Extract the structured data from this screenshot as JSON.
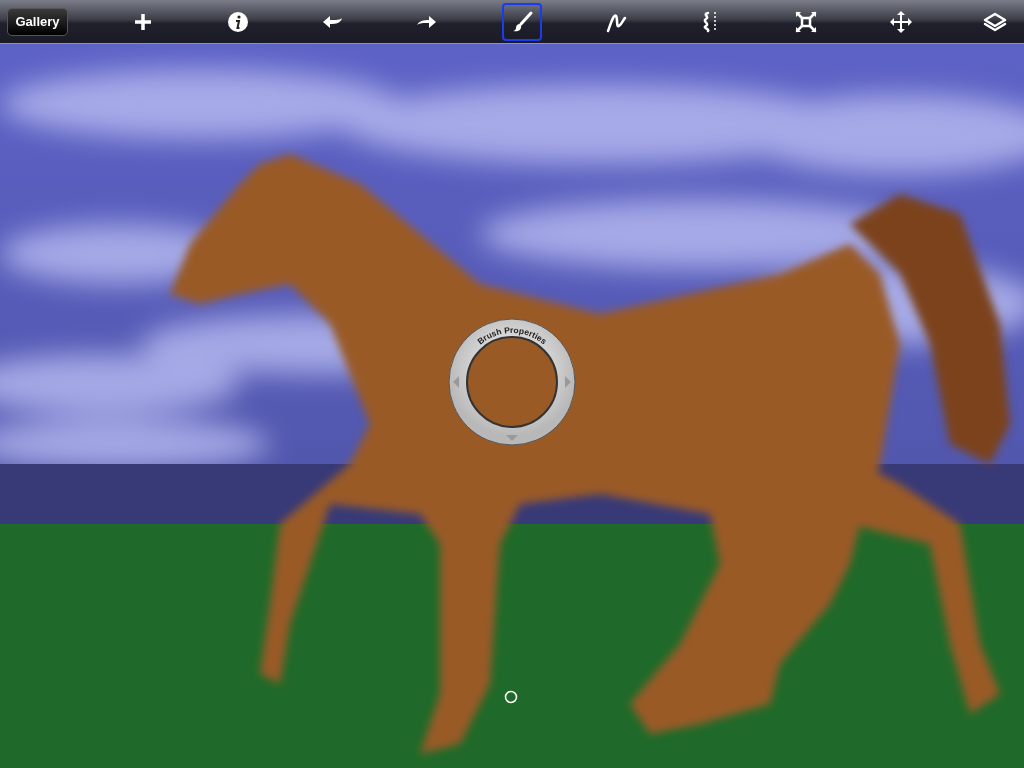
{
  "toolbar": {
    "gallery_button": "Gallery",
    "tools": [
      {
        "kind": "add",
        "selected": false
      },
      {
        "kind": "info",
        "selected": false
      },
      {
        "kind": "undo",
        "selected": false
      },
      {
        "kind": "redo",
        "selected": false
      },
      {
        "kind": "brush",
        "selected": true
      },
      {
        "kind": "stroke",
        "selected": false
      },
      {
        "kind": "symmetry",
        "selected": false
      },
      {
        "kind": "transform",
        "selected": false
      },
      {
        "kind": "move",
        "selected": false
      },
      {
        "kind": "layers",
        "selected": false
      }
    ]
  },
  "brush_properties": {
    "label": "Brush Properties"
  }
}
